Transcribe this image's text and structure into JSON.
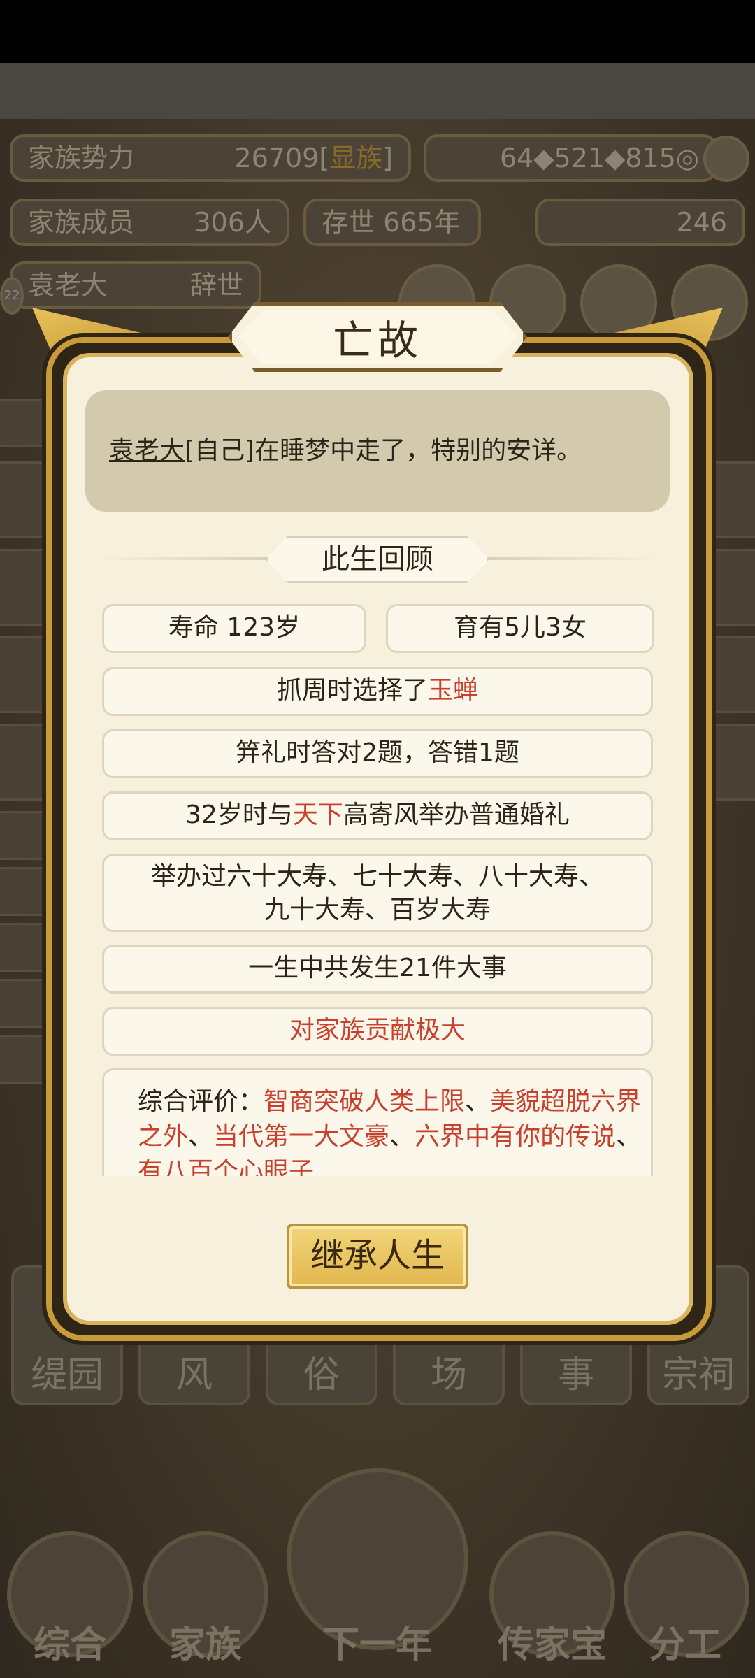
{
  "background": {
    "family_power_label": "家族势力",
    "family_power_value": "26709",
    "family_rank": "显族",
    "currency_a": "64",
    "currency_b": "521",
    "currency_c": "815",
    "members_label": "家族成员",
    "members_value": "306人",
    "existence": "存世 665年",
    "gold_value": "246",
    "person_name": "袁老大",
    "person_status": "辞世",
    "level_badge": "22",
    "bottom_cards": [
      "缇园",
      "风",
      "俗",
      "场",
      "事",
      "宗祠"
    ],
    "bottom_nav": [
      "综合",
      "家族",
      "下一年",
      "传家宝",
      "分工"
    ]
  },
  "dialog": {
    "title": "亡故",
    "message_name": "袁老大",
    "message_rest": "[自己]在睡梦中走了，特别的安详。",
    "section_title": "此生回顾",
    "lifespan": "寿命 123岁",
    "children": "育有5儿3女",
    "zhuazhou_prefix": "抓周时选择了",
    "zhuazhou_item": "玉蝉",
    "jili": "笄礼时答对2题，答错1题",
    "marriage_prefix": "32岁时与",
    "marriage_clan": "天下",
    "marriage_suffix": "高寄风举办普通婚礼",
    "birthdays_line1": "举办过六十大寿、七十大寿、八十大寿、",
    "birthdays_line2": "九十大寿、百岁大寿",
    "events": "一生中共发生21件大事",
    "contribution": "对家族贡献极大",
    "overall_label": "综合评价：",
    "overall_items": [
      "智商突破人类上限",
      "美貌超脱六界之外",
      "当代第一大文豪",
      "六界中有你的传说",
      "有八百个心眼子"
    ],
    "overall_sep": "、",
    "inherit_button": "继承人生"
  }
}
